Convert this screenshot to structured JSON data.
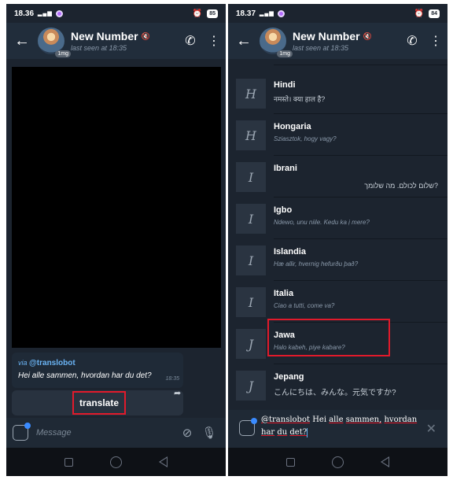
{
  "left": {
    "status": {
      "time": "18.36",
      "battery": "85"
    },
    "header": {
      "title": "New Number",
      "subtitle": "last seen at 18:35",
      "avatar_badge": "1mg"
    },
    "bubble": {
      "via_prefix": "via",
      "via_bot": "@translobot",
      "text": "Hei alle sammen, hvordan har du det?",
      "time": "18:35"
    },
    "inline_button": "translate",
    "input": {
      "placeholder": "Message"
    }
  },
  "right": {
    "status": {
      "time": "18.37",
      "battery": "84"
    },
    "header": {
      "title": "New Number",
      "subtitle": "last seen at 18:35",
      "avatar_badge": "1mg"
    },
    "languages": [
      {
        "letter": "H",
        "name": "Hindi",
        "sample": "नमस्ते। क्या हाल है?"
      },
      {
        "letter": "H",
        "name": "Hongaria",
        "sample": "Sziasztok, hogy vagy?"
      },
      {
        "letter": "I",
        "name": "Ibrani",
        "sample": "שלום לכולם. מה שלומך?"
      },
      {
        "letter": "I",
        "name": "Igbo",
        "sample": "Ndewo, unu niile. Kedu ka ị mere?"
      },
      {
        "letter": "I",
        "name": "Islandia",
        "sample": "Hæ allir, hvernig hefurðu það?"
      },
      {
        "letter": "I",
        "name": "Italia",
        "sample": "Ciao a tutti, come va?"
      },
      {
        "letter": "J",
        "name": "Jawa",
        "sample": "Halo kabeh, piye kabare?"
      },
      {
        "letter": "J",
        "name": "Jepang",
        "sample": "こんにちは、みんな。元気ですか?"
      }
    ],
    "compose": {
      "line1": [
        "@translobot",
        "Hei",
        "alle",
        "sammen,",
        "hvordan"
      ],
      "line2": [
        "har",
        "du",
        "det?"
      ]
    }
  }
}
